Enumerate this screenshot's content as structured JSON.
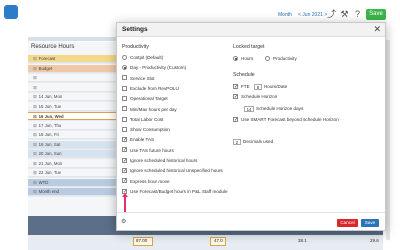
{
  "topbar": {
    "week_label": "Month",
    "date_label": "< Jun 2021 >",
    "save_label": "Save"
  },
  "background": {
    "panel_title": "Resource Hours",
    "rows": [
      {
        "label": "Forecast",
        "type": "forecast"
      },
      {
        "label": "Budget",
        "type": "budget"
      },
      {
        "label": "",
        "type": "plain"
      },
      {
        "label": "",
        "type": "plain"
      },
      {
        "label": "14 Jun, Mon",
        "type": "plain"
      },
      {
        "label": "15 Jun, Tue",
        "type": "plain"
      },
      {
        "label": "16 Jun, Wed",
        "type": "today"
      },
      {
        "label": "17 Jun, Thu",
        "type": "plain"
      },
      {
        "label": "18 Jun, Fri",
        "type": "plain"
      },
      {
        "label": "19 Jun, Sat",
        "type": "weekend"
      },
      {
        "label": "20 Jun, Sun",
        "type": "weekend"
      },
      {
        "label": "21 Jun, Mon",
        "type": "plain"
      },
      {
        "label": "22 Jun, Tue",
        "type": "plain"
      },
      {
        "label": "WTD",
        "type": "summary"
      },
      {
        "label": "Month end",
        "type": "summary"
      }
    ],
    "bottom_values": [
      "87.00",
      "47.0",
      "38.1",
      "29.6"
    ]
  },
  "modal": {
    "title": "Settings",
    "close": "✕",
    "productivity": {
      "heading": "Productivity",
      "options": [
        {
          "label": "Costpit (Default)",
          "kind": "radio",
          "checked": false
        },
        {
          "label": "Day - Productivity (Custom)",
          "kind": "radio",
          "checked": true
        },
        {
          "label": "Service Slot",
          "kind": "check",
          "checked": false
        },
        {
          "label": "Exclude from RevPOLU",
          "kind": "check",
          "checked": false
        },
        {
          "label": "Operational Target",
          "kind": "check",
          "checked": false
        },
        {
          "label": "Min/Max hours per day",
          "kind": "check",
          "checked": false
        },
        {
          "label": "Total Labor Cost",
          "kind": "check",
          "checked": false
        },
        {
          "label": "Show Consumption",
          "kind": "check",
          "checked": false
        },
        {
          "label": "Enable TAS",
          "kind": "check",
          "checked": true
        },
        {
          "label": "Use TAS future hours",
          "kind": "check",
          "checked": true
        },
        {
          "label": "Ignore scheduled historical hours",
          "kind": "check",
          "checked": true
        },
        {
          "label": "Ignore scheduled historical Unspecified hours",
          "kind": "check",
          "checked": true
        },
        {
          "label": "Express hour move",
          "kind": "check",
          "checked": true
        },
        {
          "label": "Use Forecast/Budget hours in P&L Staff module",
          "kind": "check",
          "checked": true
        }
      ]
    },
    "locked_target": {
      "heading": "Locked target",
      "hours_label": "Hours",
      "productivity_label": "Productivity"
    },
    "schedule": {
      "heading": "Schedule",
      "fte_label": "FTE",
      "fte_value": "8",
      "fte_suffix": "Hours/Date",
      "schedule_horizon_label": "Schedule Horizon",
      "horizon_days_value": "14",
      "horizon_days_label": "Schedule Horizon days",
      "smart_forecast_label": "Use SMART Forecast beyond schedule Horizon",
      "decimals_value": "2",
      "decimals_label": "Decimals used"
    },
    "footer": {
      "cancel_label": "Cancel",
      "save_label": "Save"
    }
  }
}
